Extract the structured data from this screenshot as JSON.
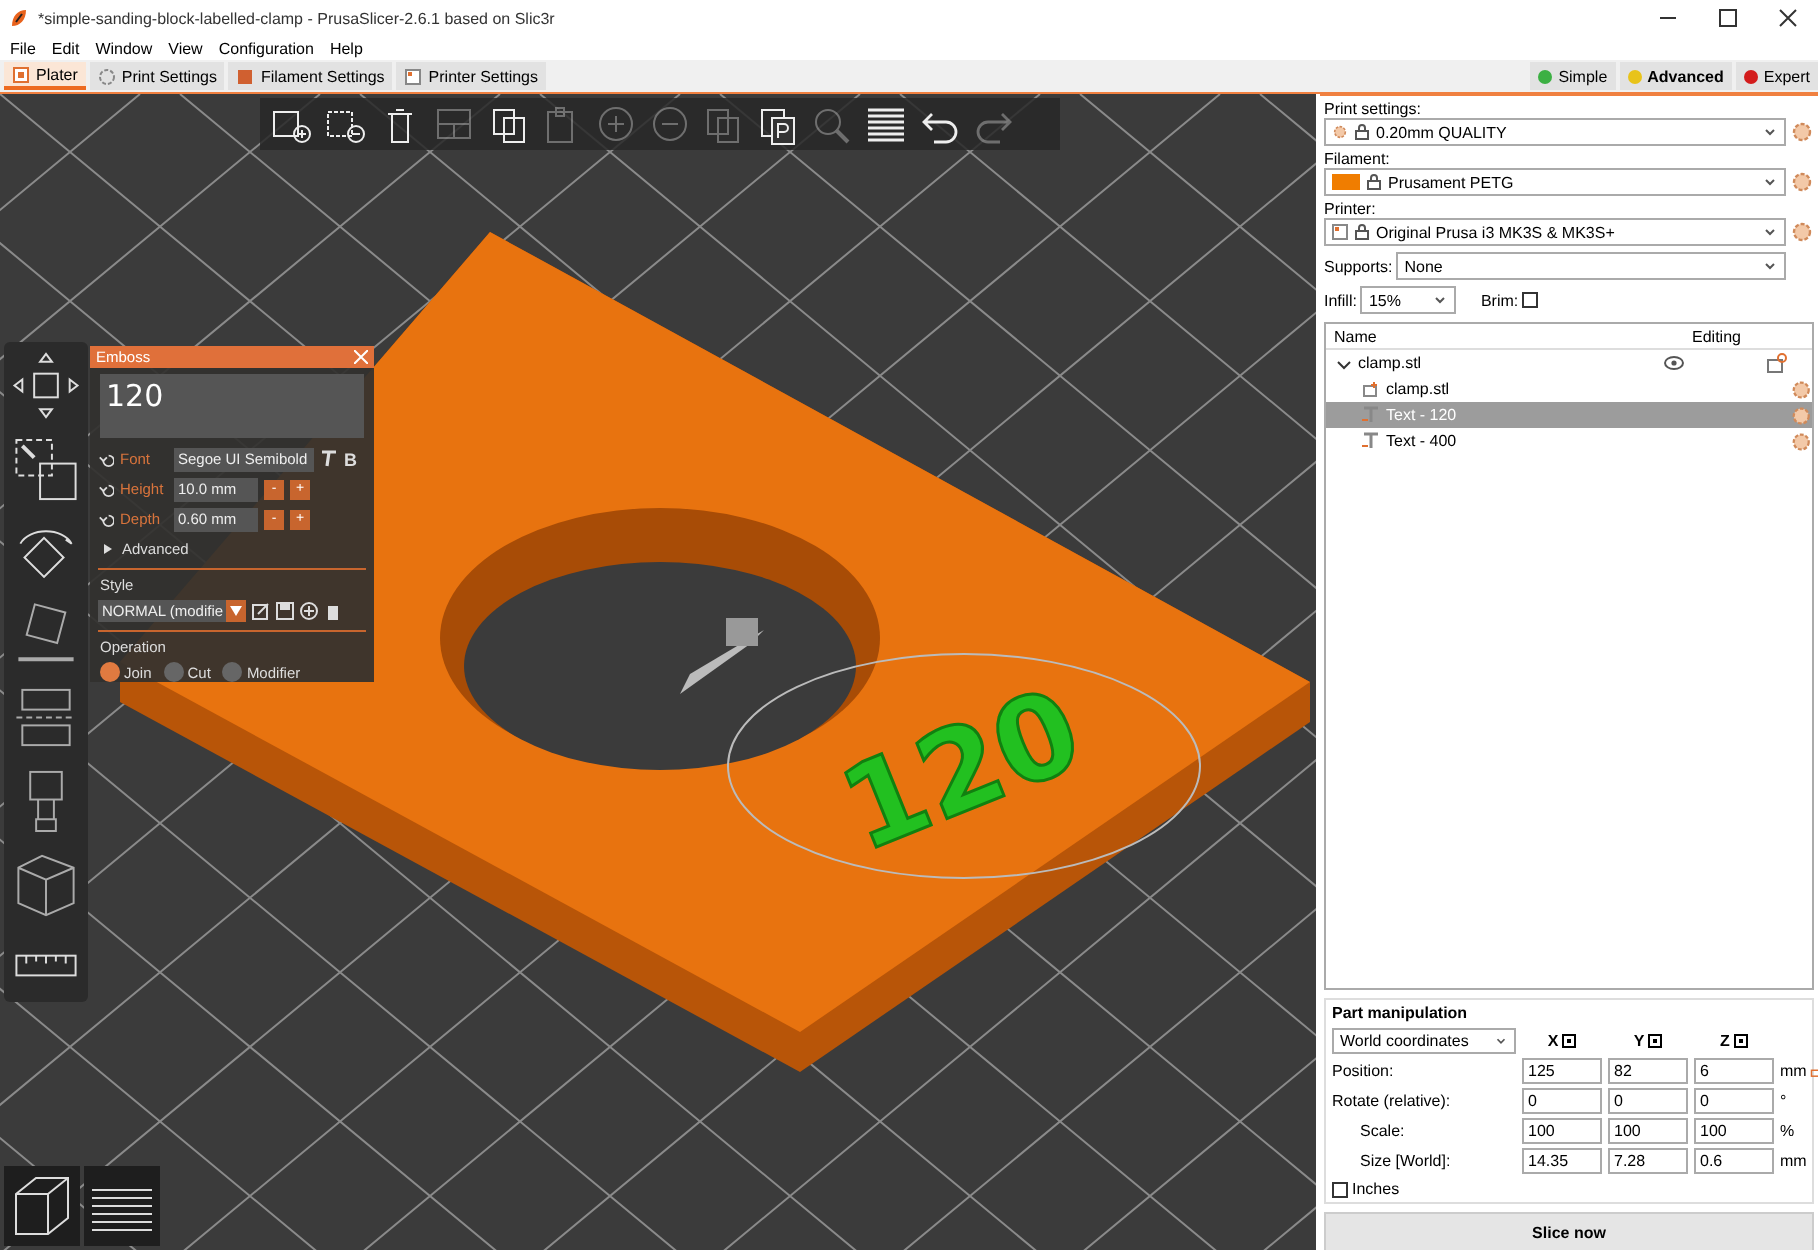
{
  "window": {
    "title": "*simple-sanding-block-labelled-clamp - PrusaSlicer-2.6.1 based on Slic3r"
  },
  "menu": [
    "File",
    "Edit",
    "Window",
    "View",
    "Configuration",
    "Help"
  ],
  "tabs": [
    {
      "label": "Plater",
      "selected": true
    },
    {
      "label": "Print Settings",
      "selected": false
    },
    {
      "label": "Filament Settings",
      "selected": false
    },
    {
      "label": "Printer Settings",
      "selected": false
    }
  ],
  "modes": [
    {
      "label": "Simple",
      "color": "#3cb043",
      "selected": false
    },
    {
      "label": "Advanced",
      "color": "#e8c31a",
      "selected": true
    },
    {
      "label": "Expert",
      "color": "#d31c1c",
      "selected": false
    }
  ],
  "toolbar": [
    {
      "disabled": false
    },
    {
      "disabled": false
    },
    {
      "disabled": false
    },
    {
      "disabled": true
    },
    {
      "disabled": false
    },
    {
      "disabled": true
    },
    {
      "disabled": true
    },
    {
      "disabled": true
    },
    {
      "disabled": true
    },
    {
      "disabled": false
    },
    {
      "disabled": true
    },
    {
      "disabled": false
    },
    {
      "disabled": false
    },
    {
      "disabled": true
    }
  ],
  "viewport": {
    "model_text": "120"
  },
  "emboss": {
    "title": "Emboss",
    "text": "120",
    "font_label": "Font",
    "font_value": "Segoe UI Semibold",
    "bold_toggle": "B",
    "height_label": "Height",
    "height_value": "10.0 mm",
    "depth_label": "Depth",
    "depth_value": "0.60 mm",
    "minus": "-",
    "plus": "+",
    "advanced": "Advanced",
    "style_label": "Style",
    "style_value": "NORMAL (modifie",
    "operation_label": "Operation",
    "operations": [
      {
        "label": "Join",
        "selected": true
      },
      {
        "label": "Cut",
        "selected": false
      },
      {
        "label": "Modifier",
        "selected": false
      }
    ]
  },
  "print_settings": {
    "label": "Print settings:",
    "value": "0.20mm QUALITY"
  },
  "filament": {
    "label": "Filament:",
    "value": "Prusament PETG"
  },
  "printer": {
    "label": "Printer:",
    "value": "Original Prusa i3 MK3S & MK3S+"
  },
  "supports": {
    "label": "Supports:",
    "value": "None"
  },
  "infill": {
    "label": "Infill:",
    "value": "15%"
  },
  "brim": {
    "label": "Brim:",
    "checked": false
  },
  "object_list": {
    "columns": [
      "Name",
      "Editing"
    ],
    "items": [
      {
        "name": "clamp.stl",
        "kind": "object",
        "expanded": true,
        "selected": false,
        "children": [
          {
            "name": "clamp.stl",
            "kind": "part",
            "selected": false
          },
          {
            "name": "Text - 120",
            "kind": "text",
            "selected": true
          },
          {
            "name": "Text - 400",
            "kind": "text",
            "selected": false
          }
        ]
      }
    ]
  },
  "part_manipulation": {
    "title": "Part manipulation",
    "coordinates": "World coordinates",
    "axes": [
      "X",
      "Y",
      "Z"
    ],
    "rows": [
      {
        "label": "Position:",
        "values": [
          "125",
          "82",
          "6"
        ],
        "unit": "mm"
      },
      {
        "label": "Rotate (relative):",
        "values": [
          "0",
          "0",
          "0"
        ],
        "unit": "°"
      },
      {
        "label": "Scale:",
        "values": [
          "100",
          "100",
          "100"
        ],
        "unit": "%"
      },
      {
        "label": "Size [World]:",
        "values": [
          "14.35",
          "7.28",
          "0.6"
        ],
        "unit": "mm"
      }
    ],
    "inches": {
      "label": "Inches",
      "checked": false
    }
  },
  "slice_button": "Slice now"
}
